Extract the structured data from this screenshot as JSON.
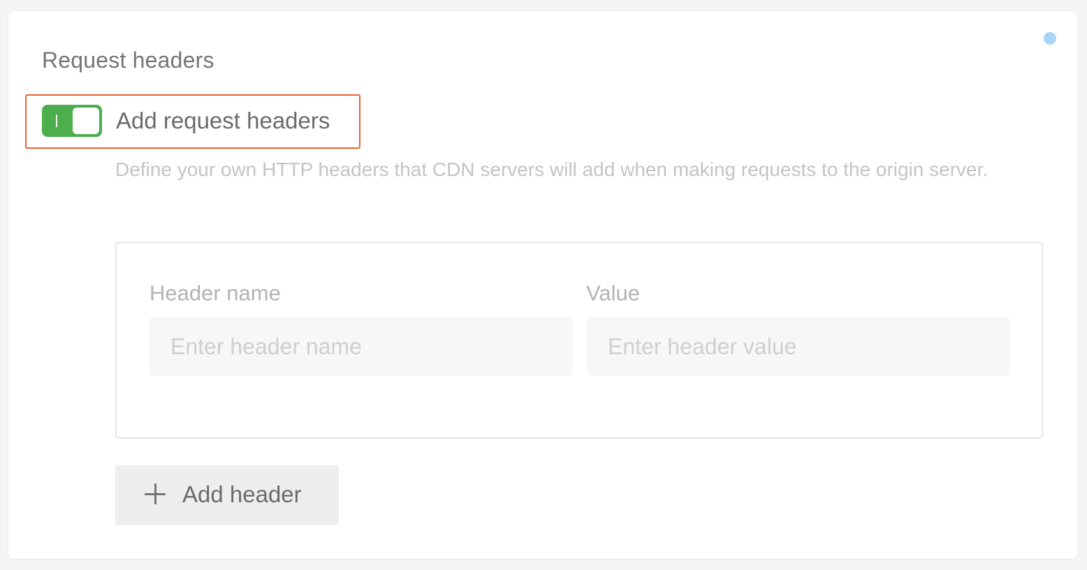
{
  "section": {
    "title": "Request headers"
  },
  "toggle": {
    "label": "Add request headers",
    "checked": true,
    "on_color": "#4cae4c",
    "border_color": "#e8622c"
  },
  "description": "Define your own HTTP headers that CDN servers will add when making requests to the origin server.",
  "fields": {
    "name_label": "Header name",
    "name_placeholder": "Enter header name",
    "value_label": "Value",
    "value_placeholder": "Enter header value"
  },
  "add_button": {
    "label": "Add header",
    "icon": "plus-icon"
  },
  "status_dot_color": "#a9d4f5"
}
